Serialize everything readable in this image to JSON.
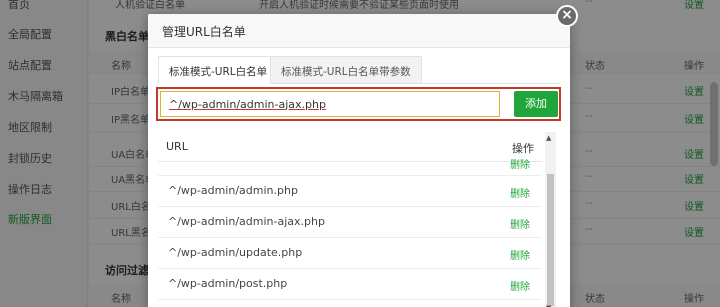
{
  "sidebar": {
    "items": [
      {
        "label": "首页"
      },
      {
        "label": "全局配置"
      },
      {
        "label": "站点配置"
      },
      {
        "label": "木马隔离箱"
      },
      {
        "label": "地区限制"
      },
      {
        "label": "封锁历史"
      },
      {
        "label": "操作日志"
      },
      {
        "label": "新版界面"
      }
    ]
  },
  "background": {
    "top_row_name": "人机验证白名单",
    "top_row_desc": "开启人机验证时候需要不验证某些页面时使用",
    "section1_title": "黑白名单",
    "section2_title": "访问过滤",
    "col_name": "名称",
    "col_status": "状态",
    "col_op": "操作",
    "dash": "--",
    "set_label": "设置",
    "rows": [
      {
        "name": "IP白名单"
      },
      {
        "name": "IP黑名单"
      },
      {
        "name": "UA白名单"
      },
      {
        "name": "UA黑名单"
      },
      {
        "name": "URL白名单"
      },
      {
        "name": "URL黑名单"
      }
    ]
  },
  "modal": {
    "title": "管理URL白名单",
    "close_glyph": "×",
    "tabs": [
      {
        "label": "标准模式-URL白名单"
      },
      {
        "label": "标准模式-URL白名单带参数"
      }
    ],
    "input_value": "^/wp-admin/admin-ajax.php",
    "add_label": "添加",
    "table": {
      "col_url": "URL",
      "col_op": "操作",
      "rows": [
        {
          "url": "^/wp-admin/admin.php",
          "op": "删除"
        },
        {
          "url": "^/wp-admin/admin-ajax.php",
          "op": "删除"
        },
        {
          "url": "^/wp-admin/update.php",
          "op": "删除"
        },
        {
          "url": "^/wp-admin/post.php",
          "op": "删除"
        }
      ],
      "partial_op": "删除"
    }
  },
  "colors": {
    "accent_green": "#20a53a",
    "highlight_red": "#c0392b",
    "input_border": "#e0b23a"
  }
}
